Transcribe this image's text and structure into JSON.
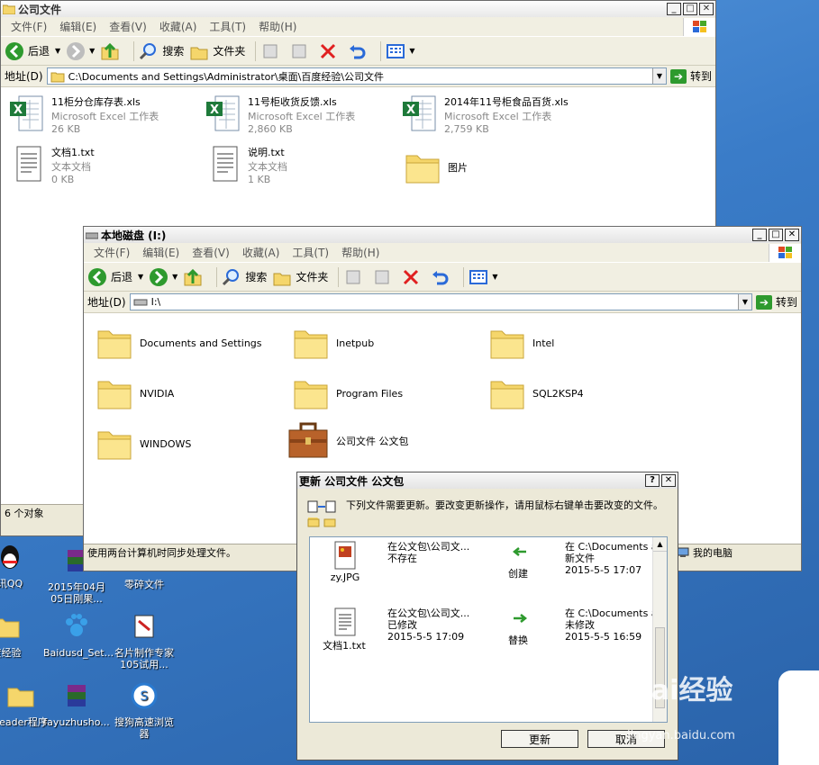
{
  "desktop": {
    "icons": [
      {
        "label": "讯QQ",
        "icon": "qq-icon"
      },
      {
        "label": "2015年04月05日刚果...",
        "icon": "rar-icon"
      },
      {
        "label": "零碎文件",
        "icon": "folder-icon"
      },
      {
        "label": "度经验",
        "icon": "folder-icon"
      },
      {
        "label": "Baidusd_Set...",
        "icon": "baidu-paw-icon"
      },
      {
        "label": "名片制作专家105试用...",
        "icon": "card-shortcut-icon"
      },
      {
        "label": "Leader程序",
        "icon": "folder-icon"
      },
      {
        "label": "fayuzhusho...",
        "icon": "rar-icon"
      },
      {
        "label": "搜狗高速浏览器",
        "icon": "sogou-browser-icon"
      }
    ]
  },
  "win1": {
    "title": "公司文件",
    "menu": [
      "文件(F)",
      "编辑(E)",
      "查看(V)",
      "收藏(A)",
      "工具(T)",
      "帮助(H)"
    ],
    "toolbar": {
      "back": "后退",
      "search": "搜索",
      "folders": "文件夹"
    },
    "address_label": "地址(D)",
    "address": "C:\\Documents and Settings\\Administrator\\桌面\\百度经验\\公司文件",
    "goto": "转到",
    "files": [
      {
        "name": "11柜分仓库存表.xls",
        "type": "Microsoft Excel 工作表",
        "size": "26 KB",
        "icon": "excel-icon"
      },
      {
        "name": "11号柜收货反馈.xls",
        "type": "Microsoft Excel 工作表",
        "size": "2,860 KB",
        "icon": "excel-icon"
      },
      {
        "name": "2014年11号柜食品百货.xls",
        "type": "Microsoft Excel 工作表",
        "size": "2,759 KB",
        "icon": "excel-icon"
      },
      {
        "name": "文档1.txt",
        "type": "文本文档",
        "size": "0 KB",
        "icon": "text-document-icon"
      },
      {
        "name": "说明.txt",
        "type": "文本文档",
        "size": "1 KB",
        "icon": "text-document-icon"
      },
      {
        "name": "图片",
        "type": "",
        "size": "",
        "icon": "folder-icon"
      }
    ],
    "status": "6 个对象"
  },
  "win2": {
    "title": "本地磁盘 (I:)",
    "menu": [
      "文件(F)",
      "编辑(E)",
      "查看(V)",
      "收藏(A)",
      "工具(T)",
      "帮助(H)"
    ],
    "toolbar": {
      "back": "后退",
      "search": "搜索",
      "folders": "文件夹"
    },
    "address_label": "地址(D)",
    "address": "I:\\",
    "goto": "转到",
    "items": [
      {
        "name": "Documents and Settings",
        "icon": "folder-icon"
      },
      {
        "name": "Inetpub",
        "icon": "folder-icon"
      },
      {
        "name": "Intel",
        "icon": "folder-icon"
      },
      {
        "name": "NVIDIA",
        "icon": "folder-icon"
      },
      {
        "name": "Program Files",
        "icon": "folder-icon"
      },
      {
        "name": "SQL2KSP4",
        "icon": "folder-icon"
      },
      {
        "name": "WINDOWS",
        "icon": "folder-icon"
      },
      {
        "name": "公司文件 公文包",
        "icon": "briefcase-icon"
      }
    ],
    "status": "使用两台计算机时同步处理文件。",
    "status_right": "我的电脑"
  },
  "dialog": {
    "title": "更新 公司文件 公文包",
    "message": "下列文件需要更新。要改变更新操作，请用鼠标右键单击要改变的文件。",
    "rows": [
      {
        "file": "zy.JPG",
        "left_line1": "在公文包\\公司文...",
        "left_line2": "不存在",
        "left_line3": "",
        "action": "创建",
        "right_line1": "在 C:\\Documents a...",
        "right_line2": "新文件",
        "right_line3": "2015-5-5 17:07"
      },
      {
        "file": "文档1.txt",
        "left_line1": "在公文包\\公司文...",
        "left_line2": "已修改",
        "left_line3": "2015-5-5 17:09",
        "action": "替换",
        "right_line1": "在 C:\\Documents a...",
        "right_line2": "未修改",
        "right_line3": "2015-5-5 16:59"
      }
    ],
    "update_button": "更新",
    "cancel_button": "取消"
  },
  "watermark": {
    "text": "Bai经验",
    "url": "jingyan.baidu.com"
  }
}
